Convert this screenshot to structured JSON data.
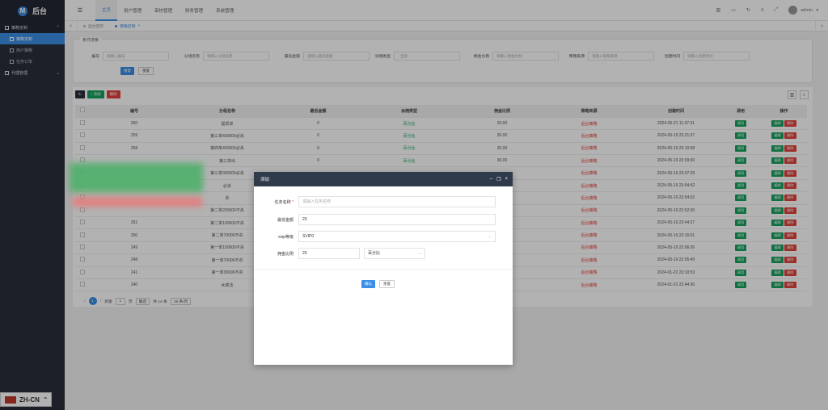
{
  "brand": {
    "logo_letter": "M",
    "name": "后台"
  },
  "sidebar": {
    "groups": [
      {
        "label": "策略定制",
        "items": [
          "策略定制",
          "用户策略",
          "任务订单"
        ]
      },
      {
        "label": "代理管理"
      }
    ]
  },
  "topbar": {
    "menu_icon": "☰",
    "tabs": [
      "主页",
      "用户管理",
      "审核管理",
      "财务管理",
      "系统管理"
    ],
    "username": "admin"
  },
  "pagetabs": {
    "tabs": [
      "后台首页",
      "策略定制"
    ]
  },
  "search": {
    "legend": "条件搜索",
    "fields": [
      {
        "label": "编号",
        "placeholder": "请输入编号"
      },
      {
        "label": "分组名称",
        "placeholder": "请输入分组名称"
      },
      {
        "label": "最低金额",
        "placeholder": "请输入最低金额"
      },
      {
        "label": "派佣类型",
        "placeholder": "- 全部 -"
      },
      {
        "label": "佣金比例",
        "placeholder": "请输入佣金比例"
      },
      {
        "label": "策略来源",
        "placeholder": "请输入策略来源"
      },
      {
        "label": "创建时间",
        "placeholder": "请输入创建时间"
      }
    ],
    "search_btn": "搜索",
    "reset_btn": "重置"
  },
  "toolbar": {
    "add": "+ 添加",
    "delete": "删除"
  },
  "table": {
    "headers": [
      "编号",
      "分组名称",
      "最低金额",
      "派佣类型",
      "佣金比例",
      "策略来源",
      "创建时间",
      "调用",
      "操作"
    ],
    "call_btn": "调用",
    "edit_btn": "编辑",
    "del_btn": "删除",
    "rows": [
      {
        "id": "260",
        "name": "提现单",
        "min": "0",
        "type": "百分比",
        "ratio": "20.00",
        "source": "后台策略",
        "time": "2024-05-21 11:37:31"
      },
      {
        "id": "259",
        "name": "第三单400000必杀",
        "min": "0",
        "type": "百分比",
        "ratio": "30.00",
        "source": "后台策略",
        "time": "2024-05-19 23:21:37"
      },
      {
        "id": "258",
        "name": "第四单400000必杀",
        "min": "0",
        "type": "百分比",
        "ratio": "30.00",
        "source": "后台策略",
        "time": "2024-05-19 23:10:58"
      },
      {
        "id": "",
        "name": "第三单出",
        "min": "0",
        "type": "百分比",
        "ratio": "30.00",
        "source": "后台策略",
        "time": "2024-05-19 23:09:00"
      },
      {
        "id": "",
        "name": "第三单300000必杀",
        "min": "",
        "type": "",
        "ratio": "",
        "source": "后台策略",
        "time": "2024-05-19 23:07:29"
      },
      {
        "id": "",
        "name": "必杀",
        "min": "",
        "type": "",
        "ratio": "",
        "source": "后台策略",
        "time": "2024-05-19 23:04:42"
      },
      {
        "id": "",
        "name": "杀",
        "min": "",
        "type": "",
        "ratio": "",
        "source": "后台策略",
        "time": "2024-05-19 22:54:02"
      },
      {
        "id": "",
        "name": "第二单200000不杀",
        "min": "",
        "type": "",
        "ratio": "",
        "source": "后台策略",
        "time": "2024-05-19 22:52:30"
      },
      {
        "id": "251",
        "name": "第二单100000不杀",
        "min": "",
        "type": "",
        "ratio": "",
        "source": "后台策略",
        "time": "2024-05-19 22:44:27"
      },
      {
        "id": "250",
        "name": "第二单70000不杀",
        "min": "",
        "type": "",
        "ratio": "",
        "source": "后台策略",
        "time": "2024-05-19 22:16:01"
      },
      {
        "id": "249",
        "name": "第一单100000不杀",
        "min": "",
        "type": "",
        "ratio": "",
        "source": "后台策略",
        "time": "2024-05-19 22:06:26"
      },
      {
        "id": "248",
        "name": "第一单70000不杀",
        "min": "",
        "type": "",
        "ratio": "",
        "source": "后台策略",
        "time": "2024-05-19 22:05:49"
      },
      {
        "id": "241",
        "name": "第一单30000不杀",
        "min": "",
        "type": "",
        "ratio": "",
        "source": "后台策略",
        "time": "2024-01-22 23:10:53"
      },
      {
        "id": "240",
        "name": "水菜法",
        "min": "",
        "type": "",
        "ratio": "",
        "source": "后台策略",
        "time": "2024-01-22 22:44:30"
      }
    ]
  },
  "pager": {
    "current": "1",
    "goto_label": "到第",
    "goto_value": "1",
    "page_suffix": "页",
    "confirm": "确定",
    "total": "共 14 条",
    "per_page": "15 条/页"
  },
  "dialog": {
    "title": "添加",
    "fields": {
      "task_name": {
        "label": "任务名称",
        "required_mark": "*",
        "placeholder": "请输入任务名称"
      },
      "min_amount": {
        "label": "最低金额",
        "value": "20"
      },
      "svip": {
        "label": "svip等级",
        "value": "SVIP0"
      },
      "ratio": {
        "label": "佣金比例",
        "value": "20",
        "type_value": "百分比"
      }
    },
    "confirm_btn": "确认",
    "reset_btn": "重置"
  },
  "lang": {
    "code": "ZH-CN"
  },
  "colors": {
    "accent": "#3a8ee6",
    "sidebar": "#2a2f3a",
    "green": "#16a35e",
    "red": "#e0413a"
  }
}
